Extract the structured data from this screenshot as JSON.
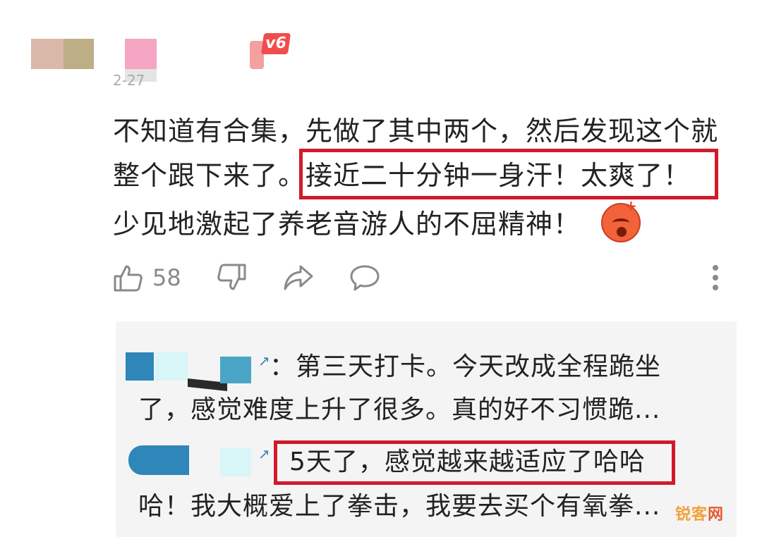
{
  "header": {
    "level_badge": "v6",
    "date": "2-27"
  },
  "comment": {
    "line1": "不知道有合集，先做了其中两个，然后发现这个就",
    "line2_prefix": "整个跟下来了。",
    "line2_highlight": "接近二十分钟一身汗！太爽了！",
    "line3": "少见地激起了养老音游人的不屈精神！",
    "emoji": "angry-face-icon"
  },
  "actions": {
    "like_count": "58",
    "icons": [
      "thumbs-up-icon",
      "thumbs-down-icon",
      "share-icon",
      "comment-icon",
      "more-icon"
    ]
  },
  "replies": [
    {
      "line1": "：第三天打卡。今天改成全程跪坐",
      "line2": "了，感觉难度上升了很多。真的好不习惯跪..."
    },
    {
      "line1_highlight": "5天了，感觉越来越适应了哈哈",
      "line2": "哈！我大概爱上了拳击，我要去买个有氧拳..."
    }
  ],
  "watermark": {
    "part1": "锐客",
    "part2": "网"
  },
  "colors": {
    "highlight_border": "#d11a2a",
    "badge": "#f24c4c",
    "icon_gray": "#8a8a8a",
    "reply_bg": "#f4f4f4"
  }
}
